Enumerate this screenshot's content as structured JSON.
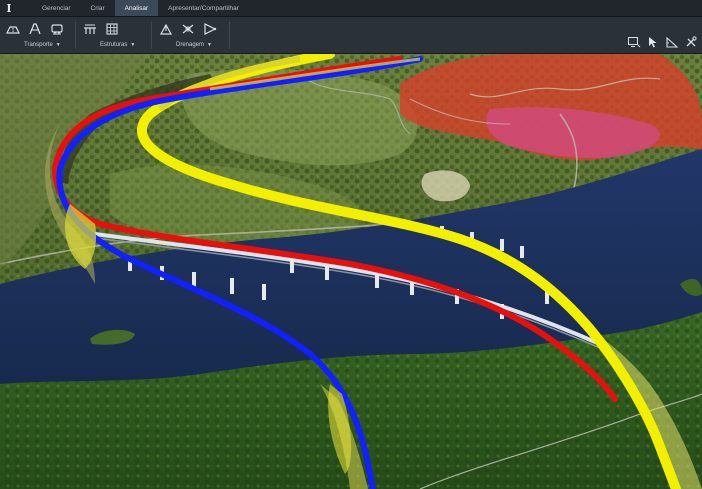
{
  "app": {
    "logo_glyph": "I"
  },
  "tabs": [
    {
      "label": "Gerenciar",
      "active": false
    },
    {
      "label": "Criar",
      "active": false
    },
    {
      "label": "Analisar",
      "active": true
    },
    {
      "label": "Apresentar/Compartilhar",
      "active": false
    }
  ],
  "ribbon": {
    "transporte": {
      "label": "Transporte",
      "icons": [
        "road-icon",
        "bridge-road-icon",
        "railway-icon"
      ]
    },
    "estruturas": {
      "label": "Estruturas",
      "icons": [
        "bridge-structure-icon",
        "grid-structure-icon"
      ]
    },
    "drenagem": {
      "label": "Drenagem",
      "icons": [
        "drainage-network-icon",
        "pipe-icon",
        "watershed-icon"
      ]
    },
    "right_icons": [
      "screen-settings-icon",
      "select-cursor-icon",
      "measure-icon",
      "tools-icon"
    ]
  },
  "colors": {
    "accent_tab": "#3a4a58",
    "route_yellow": "#f2f000",
    "route_red": "#e8100c",
    "route_blue": "#1020ff",
    "water": "#1a2f5a",
    "terrain_red_overlay": "#d8402a"
  }
}
